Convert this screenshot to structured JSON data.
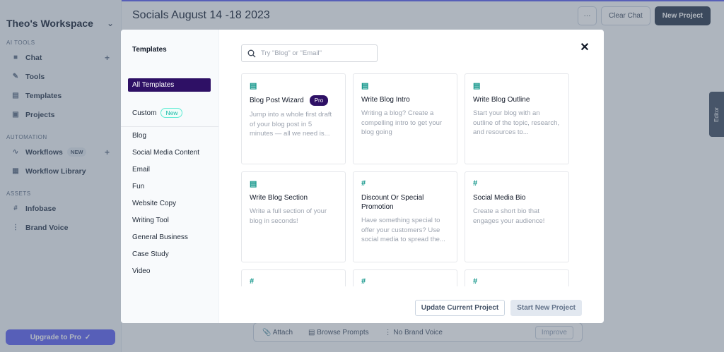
{
  "workspace": {
    "title": "Theo's Workspace"
  },
  "sidebar": {
    "sections": [
      {
        "label": "AI TOOLS"
      },
      {
        "label": "AUTOMATION"
      },
      {
        "label": "ASSETS"
      }
    ],
    "items": [
      {
        "label": "Chat"
      },
      {
        "label": "Tools"
      },
      {
        "label": "Templates"
      },
      {
        "label": "Projects"
      },
      {
        "label": "Workflows",
        "badge": "NEW"
      },
      {
        "label": "Workflow Library"
      },
      {
        "label": "Infobase"
      },
      {
        "label": "Brand Voice"
      }
    ],
    "upgrade_label": "Upgrade to Pro"
  },
  "header": {
    "title": "Socials August 14 -18 2023",
    "more_label": "···",
    "clear_label": "Clear Chat",
    "new_project_label": "New Project",
    "editor_label": "Editor"
  },
  "bottom_bar": {
    "attach": "Attach",
    "browse": "Browse Prompts",
    "brand_voice": "No Brand Voice",
    "improve": "Improve"
  },
  "modal": {
    "title": "Templates",
    "all_templates": "All Templates",
    "custom": "Custom",
    "custom_badge": "New",
    "categories": [
      "Blog",
      "Social Media Content",
      "Email",
      "Fun",
      "Website Copy",
      "Writing Tool",
      "General Business",
      "Case Study",
      "Video"
    ],
    "search_placeholder": "Try \"Blog\" or \"Email\"",
    "cards": [
      {
        "icon": "document-icon",
        "title": "Blog Post Wizard",
        "badge": "Pro",
        "desc": "Jump into a whole first draft of your blog post in 5 minutes — all we need is..."
      },
      {
        "icon": "document-icon",
        "title": "Write Blog Intro",
        "desc": "Writing a blog? Create a compelling intro to get your blog going"
      },
      {
        "icon": "document-icon",
        "title": "Write Blog Outline",
        "desc": "Start your blog with an outline of the topic, research, and resources to..."
      },
      {
        "icon": "document-icon",
        "title": "Write Blog Section",
        "desc": "Write a full section of your blog in seconds!"
      },
      {
        "icon": "hash-icon",
        "title": "Discount Or Special Promotion",
        "desc": "Have something special to offer your customers? Use social media to spread the..."
      },
      {
        "icon": "hash-icon",
        "title": "Social Media Bio",
        "desc": "Create a short bio that engages your audience!"
      },
      {
        "icon": "hash-icon",
        "title": "",
        "desc": ""
      },
      {
        "icon": "hash-icon",
        "title": "",
        "desc": ""
      },
      {
        "icon": "hash-icon",
        "title": "",
        "desc": ""
      }
    ],
    "update_label": "Update Current Project",
    "start_label": "Start New Project"
  }
}
